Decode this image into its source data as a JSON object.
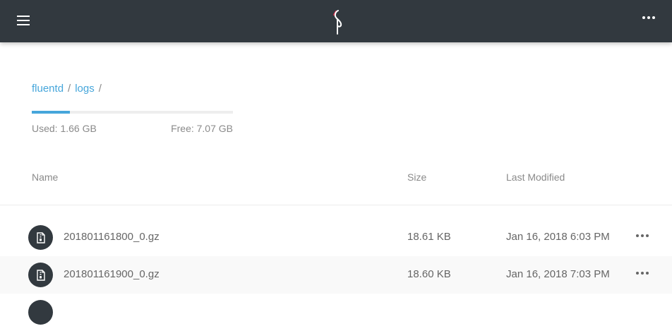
{
  "topbar": {
    "menu_icon": "hamburger-menu-icon",
    "logo_icon": "minio-flamingo-logo",
    "more_icon": "more-horizontal-icon",
    "background": "#32393f"
  },
  "breadcrumb": {
    "items": [
      "fluentd",
      "logs"
    ],
    "separator": "/"
  },
  "storage": {
    "used": "Used: 1.66 GB",
    "free": "Free: 7.07 GB",
    "used_fraction": 0.19,
    "accent": "#46a6db"
  },
  "table": {
    "columns": {
      "name": "Name",
      "size": "Size",
      "modified": "Last Modified"
    },
    "rows": [
      {
        "name": "201801161800_0.gz",
        "size": "18.61 KB",
        "modified": "Jan 16, 2018 6:03 PM",
        "icon": "file-archive-icon"
      },
      {
        "name": "201801161900_0.gz",
        "size": "18.60 KB",
        "modified": "Jan 16, 2018 7:03 PM",
        "icon": "file-archive-icon"
      }
    ]
  }
}
